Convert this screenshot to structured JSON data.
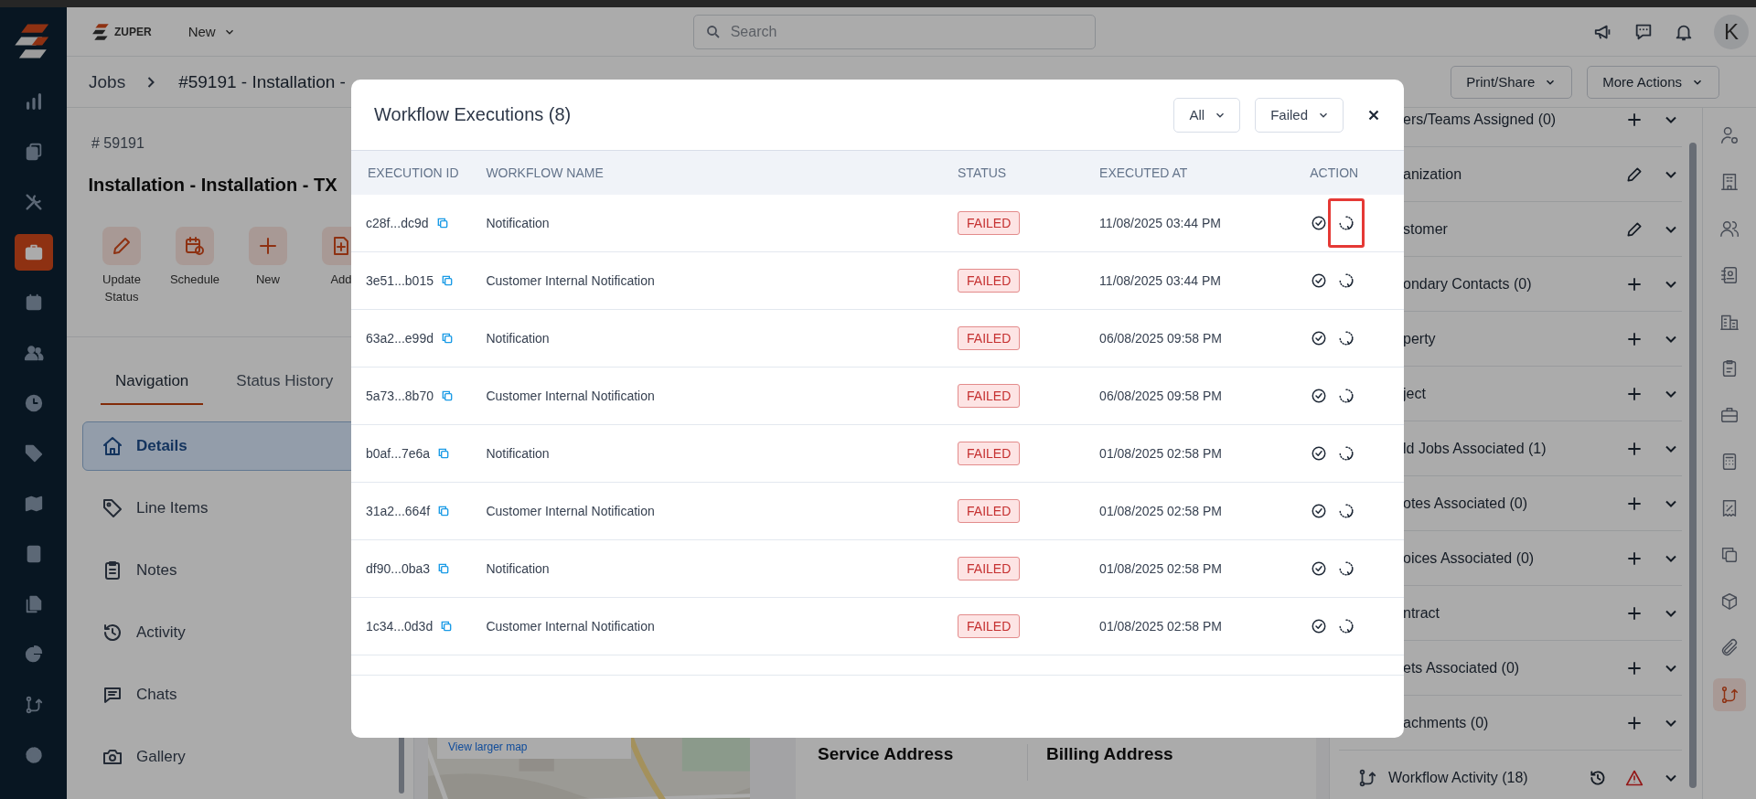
{
  "brand": {
    "name": "ZUPER"
  },
  "header": {
    "new_menu": "New",
    "search": {
      "placeholder": "Search"
    },
    "avatar": "K"
  },
  "rail": [
    {
      "selected": false
    },
    {
      "selected": false
    },
    {
      "selected": false
    },
    {
      "selected": true
    },
    {
      "selected": false
    },
    {
      "selected": false
    },
    {
      "selected": false
    },
    {
      "selected": false
    },
    {
      "selected": false
    },
    {
      "selected": false
    },
    {
      "selected": false
    },
    {
      "selected": false
    },
    {
      "selected": false
    },
    {
      "selected": false
    }
  ],
  "breadcrumb": {
    "parent": "Jobs",
    "current": "#59191 - Installation -"
  },
  "header_actions": [
    "Print/Share",
    "More Actions"
  ],
  "job": {
    "number": "# 59191",
    "title": "Installation - Installation - TX",
    "actions": [
      "Update Status",
      "Schedule",
      "New",
      "Add"
    ]
  },
  "tabs": [
    {
      "label": "Navigation",
      "selected": true
    },
    {
      "label": "Status History",
      "selected": false
    }
  ],
  "nav": [
    {
      "label": "Details",
      "selected": true
    },
    {
      "label": "Line Items",
      "selected": false
    },
    {
      "label": "Notes",
      "selected": false
    },
    {
      "label": "Activity",
      "selected": false
    },
    {
      "label": "Chats",
      "selected": false
    },
    {
      "label": "Gallery",
      "selected": false
    }
  ],
  "map": {
    "link": "View larger map"
  },
  "addresses": [
    "Service Address",
    "Billing Address"
  ],
  "sections": [
    {
      "label": "ers/Teams Assigned (0)",
      "kind": "add"
    },
    {
      "label": "anization",
      "kind": "edit"
    },
    {
      "label": "stomer",
      "kind": "edit"
    },
    {
      "label": "ondary Contacts (0)",
      "kind": "add"
    },
    {
      "label": "perty",
      "kind": "add"
    },
    {
      "label": "ject",
      "kind": "add"
    },
    {
      "label": "ld Jobs Associated (1)",
      "kind": "add"
    },
    {
      "label": "otes Associated (0)",
      "kind": "add"
    },
    {
      "label": "oices Associated (0)",
      "kind": "add"
    },
    {
      "label": "ntract",
      "kind": "add"
    },
    {
      "label": "ets Associated (0)",
      "kind": "add"
    },
    {
      "label": "achments (0)",
      "kind": "add"
    },
    {
      "label": "Workflow Activity (18)",
      "kind": "workflow"
    }
  ],
  "right_rail": [
    {
      "selected": false
    },
    {
      "selected": false
    },
    {
      "selected": false
    },
    {
      "selected": false
    },
    {
      "selected": false
    },
    {
      "selected": false
    },
    {
      "selected": false
    },
    {
      "selected": false
    },
    {
      "selected": false
    },
    {
      "selected": false
    },
    {
      "selected": false
    },
    {
      "selected": false
    },
    {
      "selected": true
    }
  ],
  "modal": {
    "title": "Workflow Executions (8)",
    "filters": [
      "All",
      "Failed"
    ],
    "columns": [
      "EXECUTION ID",
      "WORKFLOW NAME",
      "STATUS",
      "EXECUTED AT",
      "ACTION"
    ],
    "rows": [
      {
        "id": "c28f...dc9d",
        "workflow": "Notification",
        "status": "FAILED",
        "executed_at": "11/08/2025 03:44 PM",
        "highlighted": true
      },
      {
        "id": "3e51...b015",
        "workflow": "Customer Internal Notification",
        "status": "FAILED",
        "executed_at": "11/08/2025 03:44 PM",
        "highlighted": false
      },
      {
        "id": "63a2...e99d",
        "workflow": "Notification",
        "status": "FAILED",
        "executed_at": "06/08/2025 09:58 PM",
        "highlighted": false
      },
      {
        "id": "5a73...8b70",
        "workflow": "Customer Internal Notification",
        "status": "FAILED",
        "executed_at": "06/08/2025 09:58 PM",
        "highlighted": false
      },
      {
        "id": "b0af...7e6a",
        "workflow": "Notification",
        "status": "FAILED",
        "executed_at": "01/08/2025 02:58 PM",
        "highlighted": false
      },
      {
        "id": "31a2...664f",
        "workflow": "Customer Internal Notification",
        "status": "FAILED",
        "executed_at": "01/08/2025 02:58 PM",
        "highlighted": false
      },
      {
        "id": "df90...0ba3",
        "workflow": "Notification",
        "status": "FAILED",
        "executed_at": "01/08/2025 02:58 PM",
        "highlighted": false
      },
      {
        "id": "1c34...0d3d",
        "workflow": "Customer Internal Notification",
        "status": "FAILED",
        "executed_at": "01/08/2025 02:58 PM",
        "highlighted": false
      }
    ]
  }
}
